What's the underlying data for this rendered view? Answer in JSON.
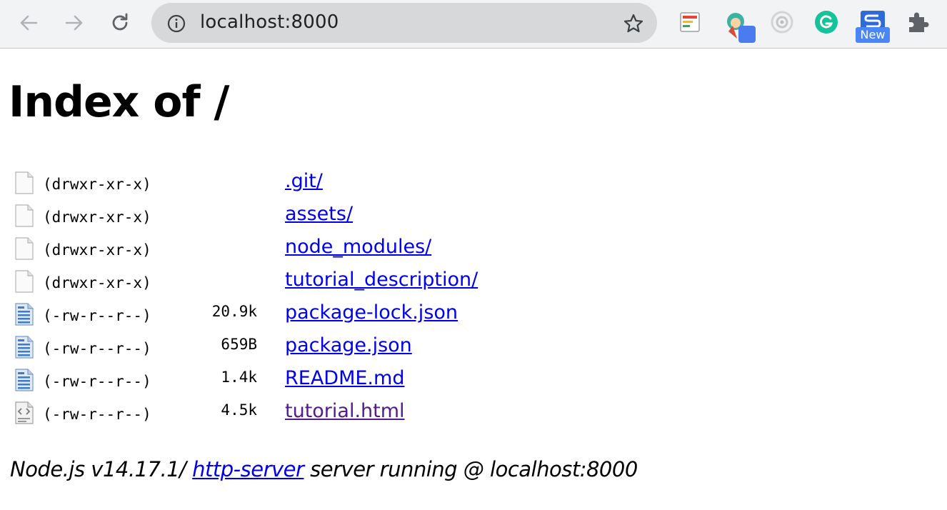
{
  "browser": {
    "url": "localhost:8000",
    "extensions": [
      {
        "name": "notes-extension-icon"
      },
      {
        "name": "avatar-extension-icon"
      },
      {
        "name": "radar-extension-icon"
      },
      {
        "name": "grammarly-extension-icon"
      },
      {
        "name": "s-extension-icon",
        "badge": "New"
      },
      {
        "name": "extensions-puzzle-icon"
      }
    ]
  },
  "page": {
    "heading": "Index of /",
    "entries": [
      {
        "perm": "(drwxr-xr-x)",
        "size": "",
        "name": ".git/",
        "icon": "folder-icon",
        "visited": false
      },
      {
        "perm": "(drwxr-xr-x)",
        "size": "",
        "name": "assets/",
        "icon": "folder-icon",
        "visited": false
      },
      {
        "perm": "(drwxr-xr-x)",
        "size": "",
        "name": "node_modules/",
        "icon": "folder-icon",
        "visited": false
      },
      {
        "perm": "(drwxr-xr-x)",
        "size": "",
        "name": "tutorial_description/",
        "icon": "folder-icon",
        "visited": false
      },
      {
        "perm": "(-rw-r--r--)",
        "size": "20.9k",
        "name": "package-lock.json",
        "icon": "text-file-icon",
        "visited": false
      },
      {
        "perm": "(-rw-r--r--)",
        "size": "659B",
        "name": "package.json",
        "icon": "text-file-icon",
        "visited": false
      },
      {
        "perm": "(-rw-r--r--)",
        "size": "1.4k",
        "name": "README.md",
        "icon": "text-file-icon",
        "visited": false
      },
      {
        "perm": "(-rw-r--r--)",
        "size": "4.5k",
        "name": "tutorial.html",
        "icon": "html-file-icon",
        "visited": true
      }
    ],
    "footer": {
      "prefix": "Node.js v14.17.1/ ",
      "link": "http-server",
      "suffix": " server running @ localhost:8000"
    }
  },
  "colors": {
    "link": "#0000ee",
    "visited": "#551a8b",
    "chrome_bg": "#f1f3f4",
    "omnibox_bg": "#d7d8da"
  }
}
